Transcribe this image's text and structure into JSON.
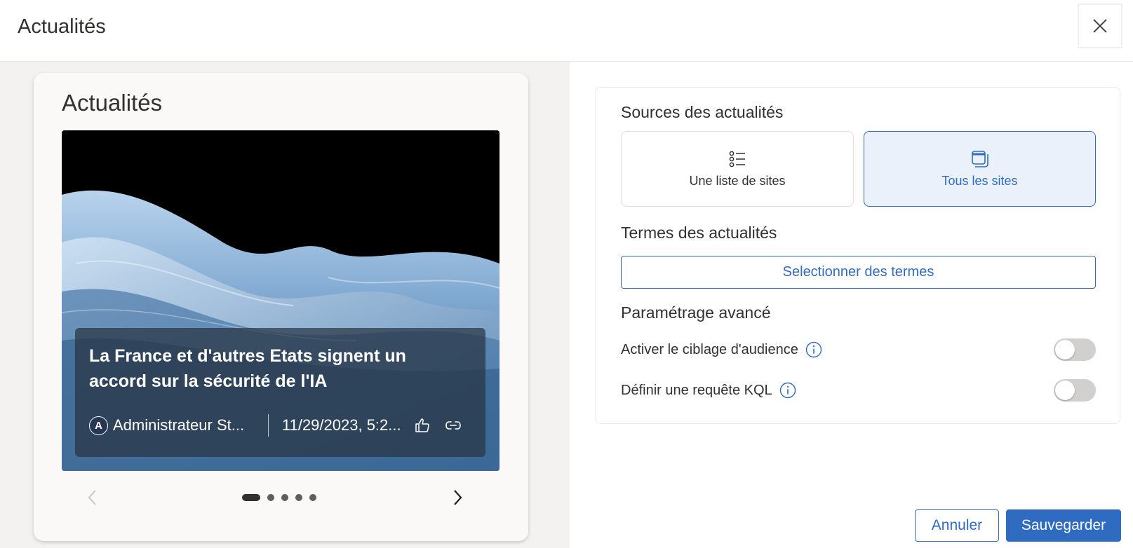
{
  "header": {
    "title": "Actualités"
  },
  "preview": {
    "card_title": "Actualités",
    "news": {
      "title": "La France et d'autres Etats signent un accord sur la sécurité de l'IA",
      "author_initial": "A",
      "author": "Administrateur St...",
      "date": "11/29/2023, 5:2..."
    },
    "carousel": {
      "total": 5,
      "active_index": 0
    }
  },
  "settings": {
    "sources_label": "Sources des actualités",
    "sources": [
      {
        "label": "Une liste de sites",
        "icon": "list-icon",
        "selected": false
      },
      {
        "label": "Tous les sites",
        "icon": "all-sites-icon",
        "selected": true
      }
    ],
    "terms_label": "Termes des actualités",
    "terms_button": "Selectionner des termes",
    "advanced_label": "Paramétrage avancé",
    "toggles": [
      {
        "label": "Activer le ciblage d'audience",
        "on": false
      },
      {
        "label": "Définir une requête KQL",
        "on": false
      }
    ]
  },
  "footer": {
    "cancel": "Annuler",
    "save": "Sauvegarder"
  },
  "colors": {
    "accent": "#2f6bc1",
    "selected_bg": "#eaf1fb",
    "toggle_off": "#d2d0ce"
  }
}
